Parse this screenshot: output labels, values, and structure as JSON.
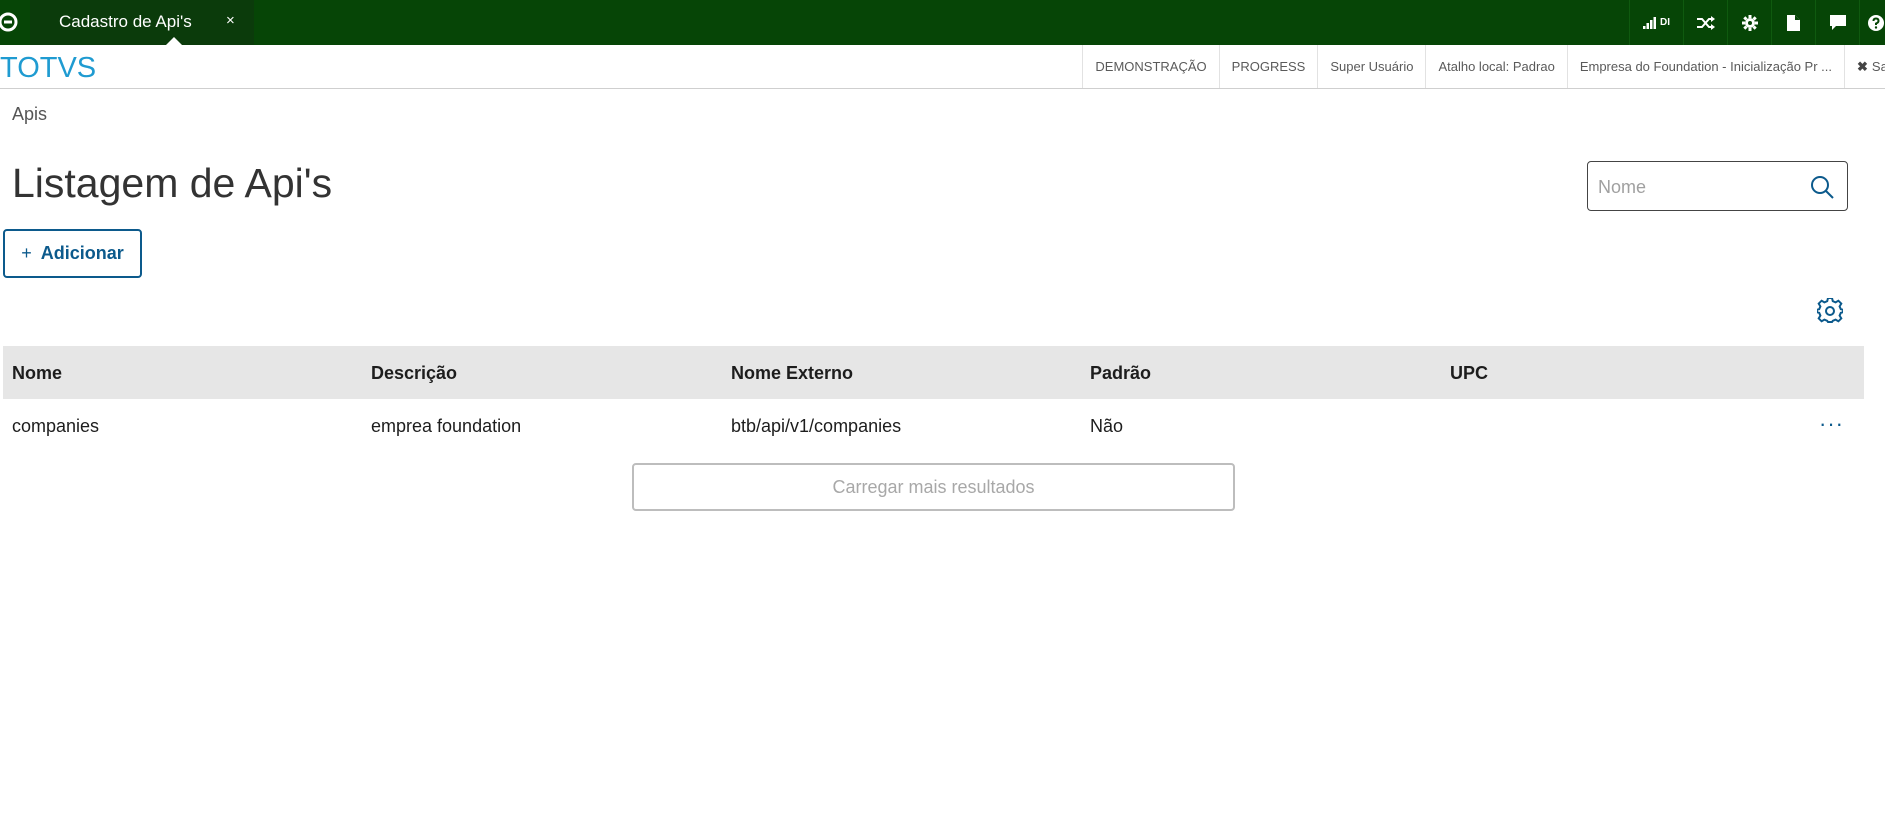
{
  "topbar": {
    "tab_label": "Cadastro de Api's",
    "tab_close": "×",
    "signal_label": "DI"
  },
  "header": {
    "brand": "TOTVS",
    "info": [
      "DEMONSTRAÇÃO",
      "PROGRESS",
      "Super Usuário",
      "Atalho local: Padrao",
      "Empresa do Foundation - Inicialização Pr ..."
    ],
    "close_label": "Sa"
  },
  "breadcrumb": "Apis",
  "page_title": "Listagem de Api's",
  "search": {
    "placeholder": "Nome"
  },
  "add_button": {
    "plus": "+",
    "label": "Adicionar"
  },
  "table": {
    "columns": [
      "Nome",
      "Descrição",
      "Nome Externo",
      "Padrão",
      "UPC"
    ],
    "rows": [
      {
        "nome": "companies",
        "descricao": "emprea foundation",
        "nome_externo": "btb/api/v1/companies",
        "padrao": "Não",
        "upc": ""
      }
    ],
    "row_actions": "···"
  },
  "load_more": "Carregar mais resultados",
  "colors": {
    "topbar": "#064506",
    "brand": "#1f9bd1",
    "accent": "#0c5a8c"
  },
  "icons": [
    "app-logo-icon",
    "signal-icon",
    "shuffle-icon",
    "gear-icon",
    "document-icon",
    "chat-icon",
    "help-icon",
    "search-icon",
    "settings-icon",
    "more-icon"
  ]
}
